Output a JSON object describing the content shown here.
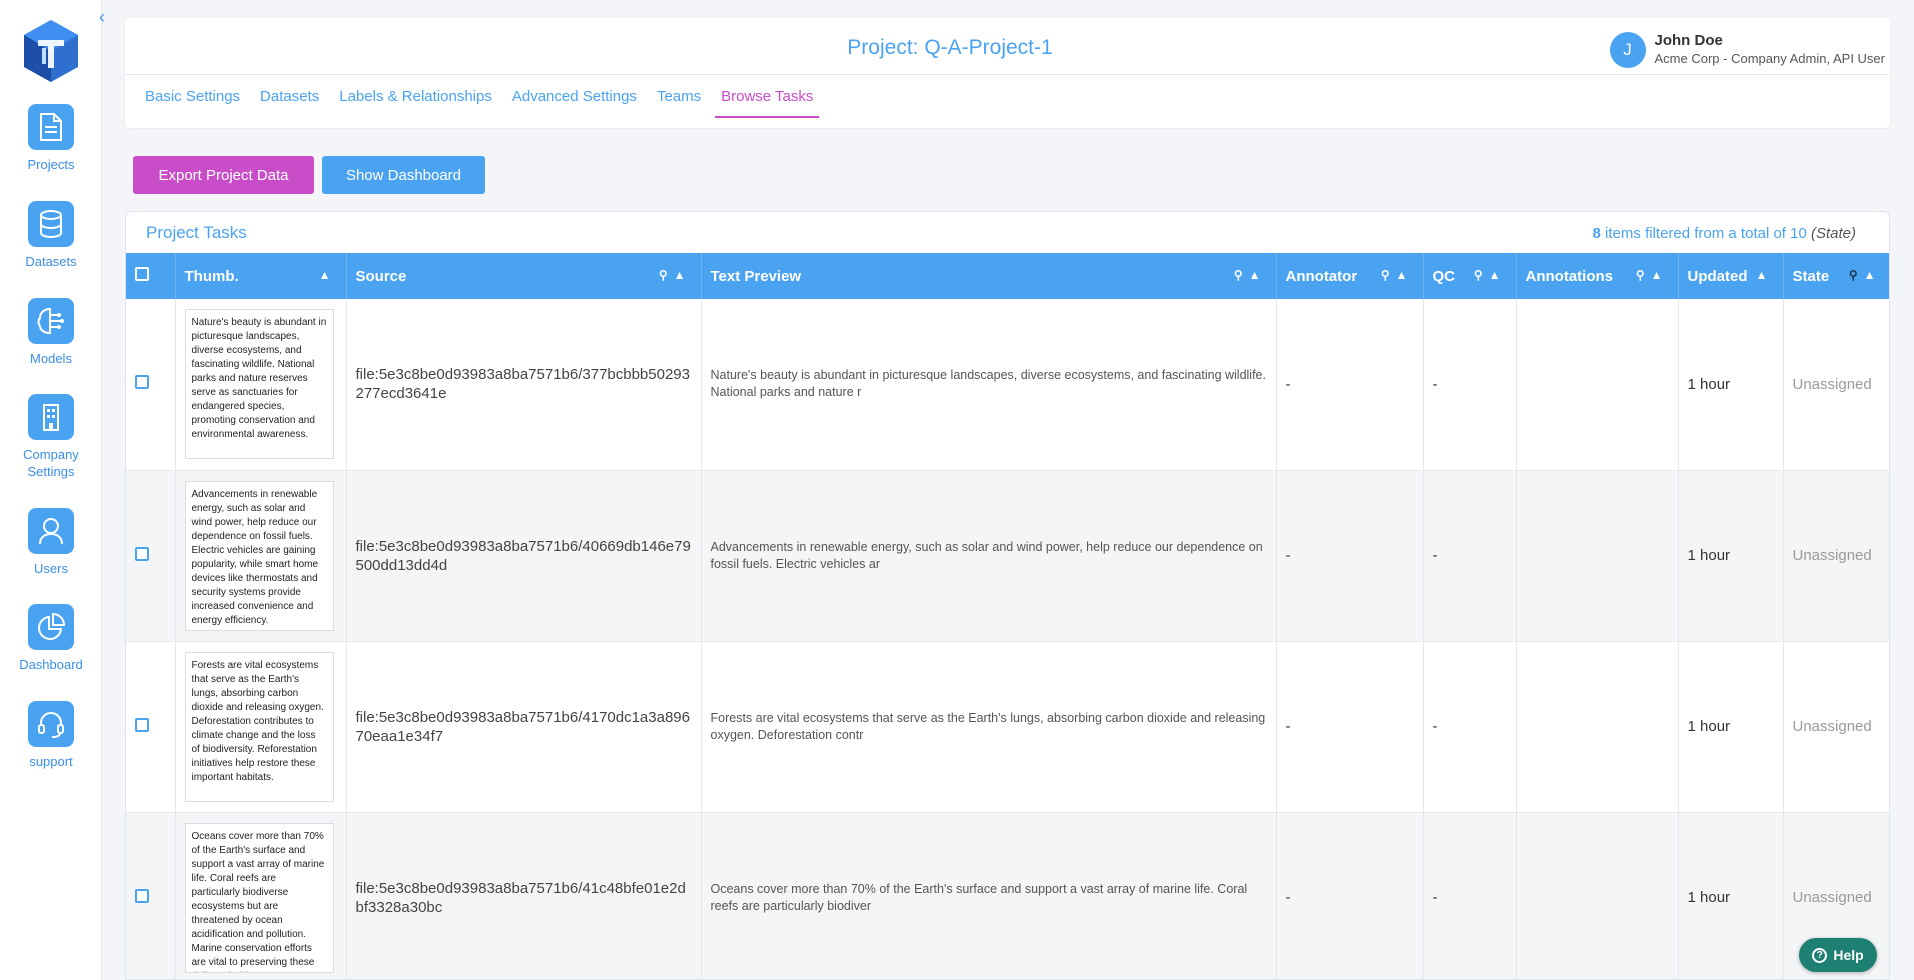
{
  "sidebar": {
    "collapse_glyph": "‹",
    "items": [
      {
        "label": "Projects",
        "icon": "document-icon"
      },
      {
        "label": "Datasets",
        "icon": "database-icon"
      },
      {
        "label": "Models",
        "icon": "brain-circuit-icon"
      },
      {
        "label": "Company\nSettings",
        "label_line1": "Company",
        "label_line2": "Settings",
        "icon": "building-icon"
      },
      {
        "label": "Users",
        "icon": "user-icon"
      },
      {
        "label": "Dashboard",
        "icon": "pie-chart-icon"
      },
      {
        "label": "support",
        "icon": "headset-icon"
      }
    ]
  },
  "header": {
    "title": "Project: Q-A-Project-1",
    "user": {
      "initial": "J",
      "name": "John Doe",
      "role": "Acme Corp - Company Admin, API User"
    },
    "tabs": [
      {
        "label": "Basic Settings",
        "active": false
      },
      {
        "label": "Datasets",
        "active": false
      },
      {
        "label": "Labels & Relationships",
        "active": false
      },
      {
        "label": "Advanced Settings",
        "active": false
      },
      {
        "label": "Teams",
        "active": false
      },
      {
        "label": "Browse Tasks",
        "active": true
      }
    ]
  },
  "actions": {
    "export_label": "Export Project Data",
    "dashboard_label": "Show Dashboard"
  },
  "tasks": {
    "title": "Project Tasks",
    "count_filtered": "8",
    "count_text": " items filtered from a total of 10 ",
    "count_filter": "(State)",
    "columns": [
      "Thumb.",
      "Source",
      "Text Preview",
      "Annotator",
      "QC",
      "Annotations",
      "Updated",
      "State"
    ],
    "rows": [
      {
        "thumb": "Nature's beauty is abundant in picturesque landscapes, diverse ecosystems, and fascinating wildlife. National parks and nature reserves serve as sanctuaries for endangered species, promoting conservation and environmental awareness.",
        "source": "file:5e3c8be0d93983a8ba7571b6/377bcbbb50293277ecd3641e",
        "preview": "Nature's beauty is abundant in picturesque landscapes, diverse ecosystems, and fascinating wildlife. National parks and nature r",
        "annotator": "-",
        "qc": "-",
        "annotations": "",
        "updated": "1 hour",
        "state": "Unassigned"
      },
      {
        "thumb": "Advancements in renewable energy, such as solar and wind power, help reduce our dependence on fossil fuels. Electric vehicles are gaining popularity, while smart home devices like thermostats and security systems provide increased convenience and energy efficiency.",
        "source": "file:5e3c8be0d93983a8ba7571b6/40669db146e79500dd13dd4d",
        "preview": "Advancements in renewable energy, such as solar and wind power, help reduce our dependence on fossil fuels. Electric vehicles ar",
        "annotator": "-",
        "qc": "-",
        "annotations": "",
        "updated": "1 hour",
        "state": "Unassigned"
      },
      {
        "thumb": "Forests are vital ecosystems that serve as the Earth's lungs, absorbing carbon dioxide and releasing oxygen. Deforestation contributes to climate change and the loss of biodiversity. Reforestation initiatives help restore these important habitats.",
        "source": "file:5e3c8be0d93983a8ba7571b6/4170dc1a3a89670eaa1e34f7",
        "preview": "Forests are vital ecosystems that serve as the Earth's lungs, absorbing carbon dioxide and releasing oxygen. Deforestation contr",
        "annotator": "-",
        "qc": "-",
        "annotations": "",
        "updated": "1 hour",
        "state": "Unassigned"
      },
      {
        "thumb": "Oceans cover more than 70% of the Earth's surface and support a vast array of marine life. Coral reefs are particularly biodiverse ecosystems but are threatened by ocean acidification and pollution. Marine conservation efforts are vital to preserving these delicate habitats.",
        "source": "file:5e3c8be0d93983a8ba7571b6/41c48bfe01e2dbf3328a30bc",
        "preview": "Oceans cover more than 70% of the Earth's surface and support a vast array of marine life. Coral reefs are particularly biodiver",
        "annotator": "-",
        "qc": "-",
        "annotations": "",
        "updated": "1 hour",
        "state": "Unassigned"
      }
    ]
  },
  "help": {
    "label": "Help"
  },
  "colors": {
    "accent": "#4aa3f0",
    "active_tab": "#c94dc9",
    "export_button": "#c94dc9",
    "help_button": "#1e7f73"
  }
}
